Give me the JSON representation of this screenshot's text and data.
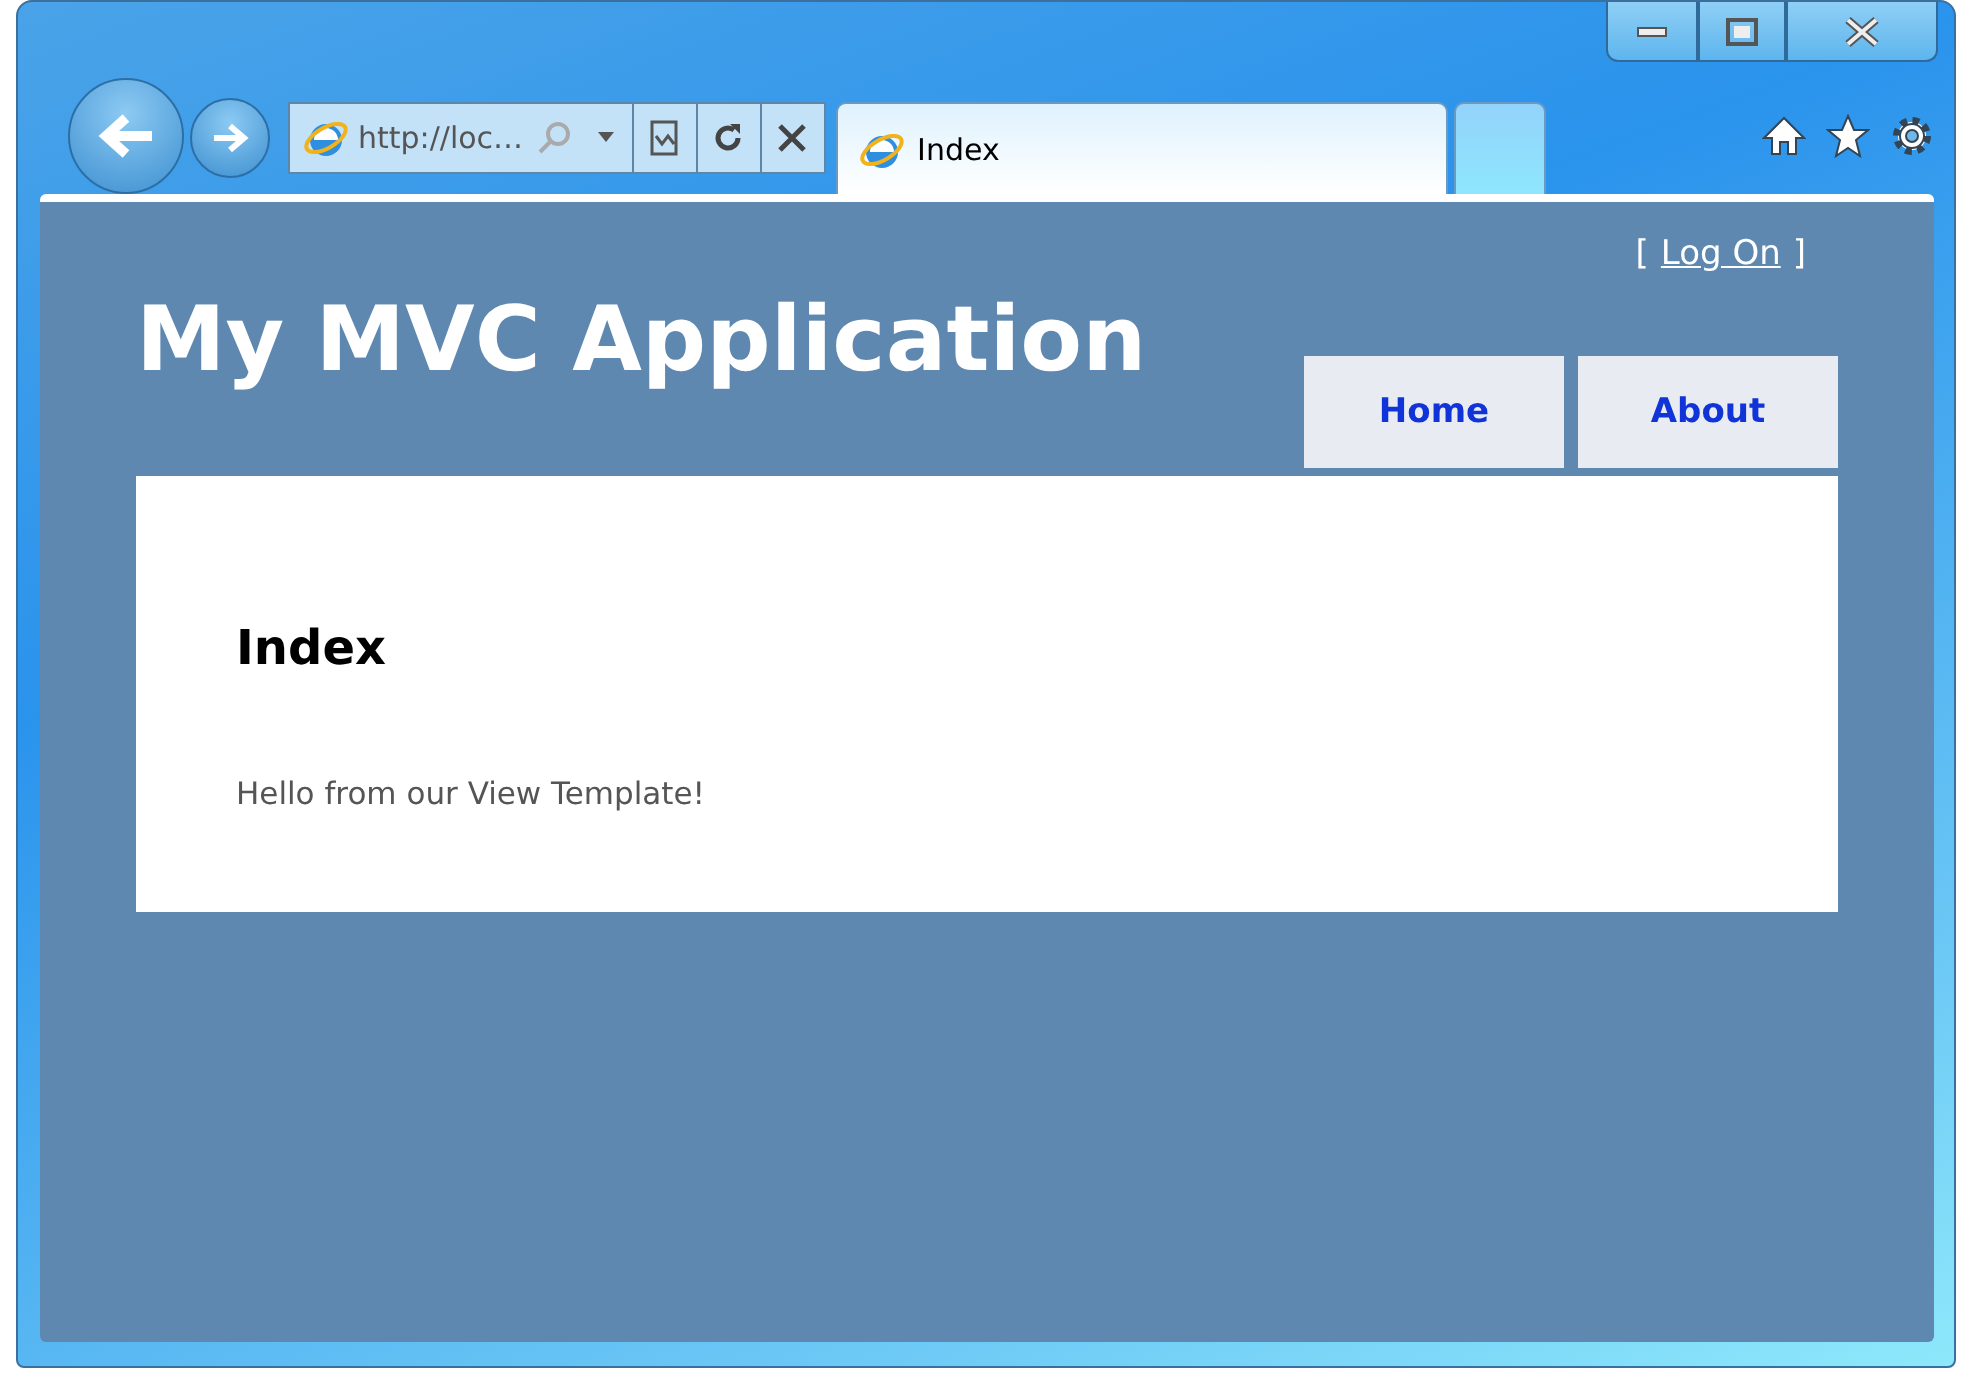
{
  "browser": {
    "address": "http://loc…",
    "tab_title": "Index"
  },
  "page": {
    "login": {
      "open_bracket": "[",
      "link": "Log On",
      "close_bracket": "]"
    },
    "title": "My MVC Application",
    "nav": [
      {
        "label": "Home"
      },
      {
        "label": "About"
      }
    ],
    "heading": "Index",
    "body": "Hello from our View Template!"
  }
}
